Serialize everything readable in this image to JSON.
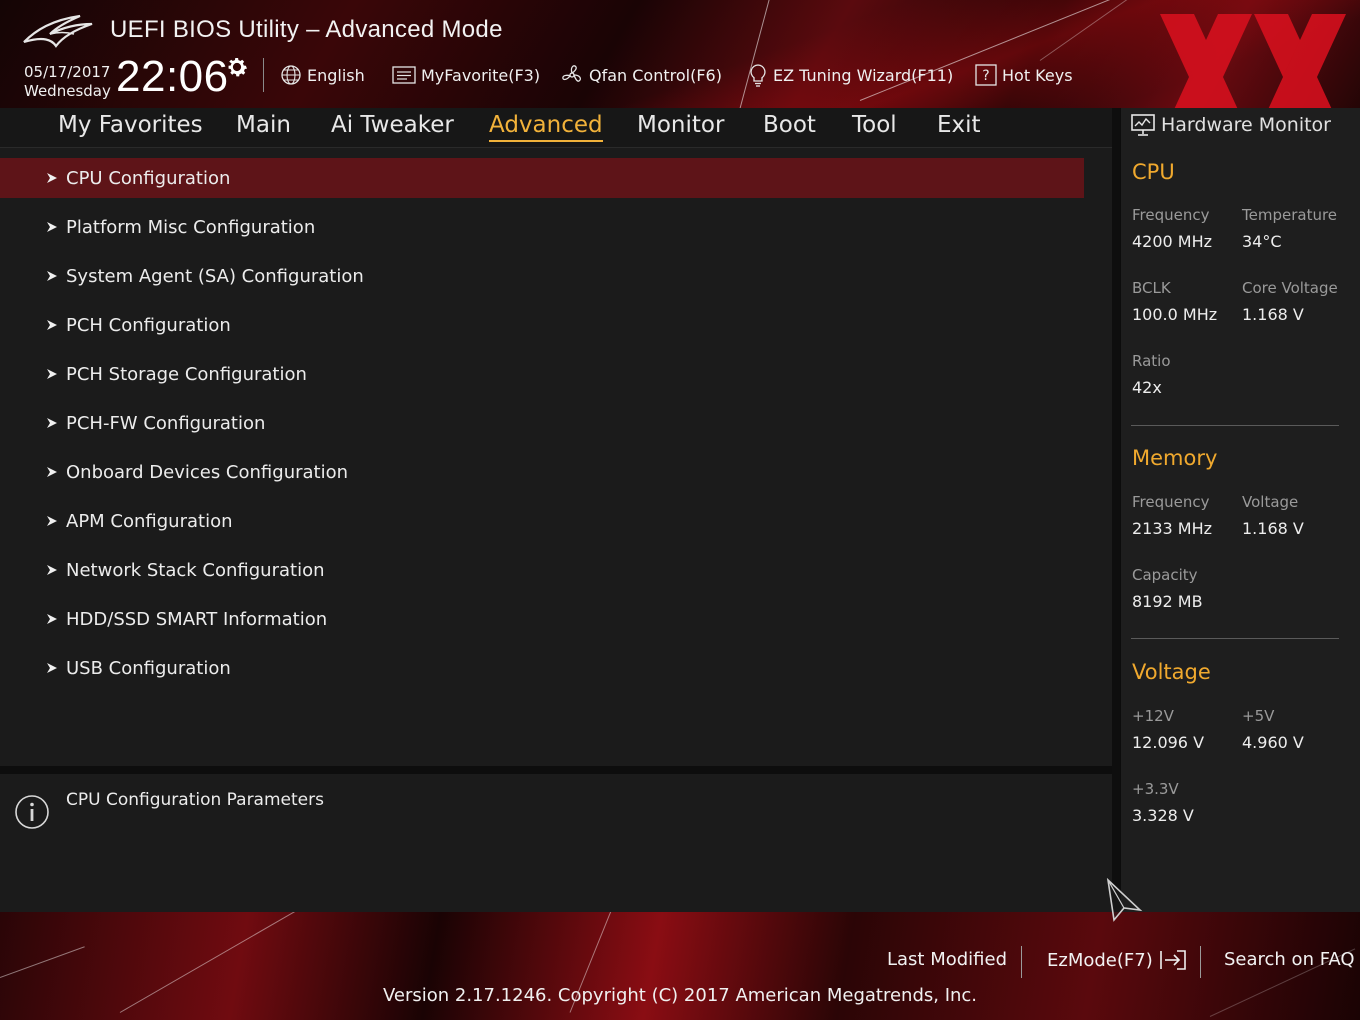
{
  "header": {
    "title": "UEFI BIOS Utility – Advanced Mode",
    "date": "05/17/2017",
    "day": "Wednesday",
    "time": "22:06",
    "toolbar": [
      {
        "label": "English",
        "icon": "globe-icon"
      },
      {
        "label": "MyFavorite(F3)",
        "icon": "favorite-list-icon"
      },
      {
        "label": "Qfan Control(F6)",
        "icon": "fan-icon"
      },
      {
        "label": "EZ Tuning Wizard(F11)",
        "icon": "lightbulb-icon"
      },
      {
        "label": "Hot Keys",
        "icon": "question-box-icon"
      }
    ]
  },
  "nav": {
    "tabs": [
      {
        "label": "My Favorites"
      },
      {
        "label": "Main"
      },
      {
        "label": "Ai Tweaker"
      },
      {
        "label": "Advanced",
        "active": true
      },
      {
        "label": "Monitor"
      },
      {
        "label": "Boot"
      },
      {
        "label": "Tool"
      },
      {
        "label": "Exit"
      }
    ]
  },
  "menu": {
    "items": [
      {
        "label": "CPU Configuration",
        "selected": true
      },
      {
        "label": "Platform Misc Configuration"
      },
      {
        "label": "System Agent (SA) Configuration"
      },
      {
        "label": "PCH Configuration"
      },
      {
        "label": "PCH Storage Configuration"
      },
      {
        "label": "PCH-FW Configuration"
      },
      {
        "label": "Onboard Devices Configuration"
      },
      {
        "label": "APM Configuration"
      },
      {
        "label": "Network Stack Configuration"
      },
      {
        "label": "HDD/SSD SMART Information"
      },
      {
        "label": "USB Configuration"
      }
    ]
  },
  "help": {
    "text": "CPU Configuration Parameters"
  },
  "hardware_monitor": {
    "title": "Hardware Monitor",
    "cpu": {
      "heading": "CPU",
      "frequency_label": "Frequency",
      "frequency": "4200 MHz",
      "temperature_label": "Temperature",
      "temperature": "34°C",
      "bclk_label": "BCLK",
      "bclk": "100.0 MHz",
      "core_voltage_label": "Core Voltage",
      "core_voltage": "1.168 V",
      "ratio_label": "Ratio",
      "ratio": "42x"
    },
    "memory": {
      "heading": "Memory",
      "frequency_label": "Frequency",
      "frequency": "2133 MHz",
      "voltage_label": "Voltage",
      "voltage": "1.168 V",
      "capacity_label": "Capacity",
      "capacity": "8192 MB"
    },
    "voltage": {
      "heading": "Voltage",
      "v12_label": "+12V",
      "v12": "12.096 V",
      "v5_label": "+5V",
      "v5": "4.960 V",
      "v33_label": "+3.3V",
      "v33": "3.328 V"
    }
  },
  "footer": {
    "last_modified": "Last Modified",
    "ezmode": "EzMode(F7)",
    "search": "Search on FAQ",
    "version": "Version 2.17.1246. Copyright (C) 2017 American Megatrends, Inc."
  },
  "colors": {
    "accent": "#f2b23a",
    "selected_row": "#5e1418",
    "brand_red": "#8a0d13"
  }
}
